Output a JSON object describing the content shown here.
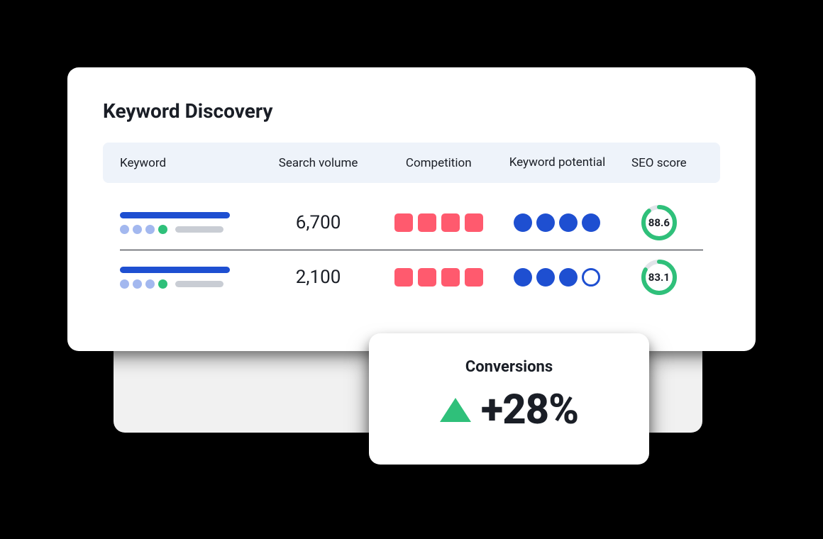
{
  "card": {
    "title": "Keyword Discovery",
    "columns": {
      "keyword": "Keyword",
      "volume": "Search volume",
      "competition": "Competition",
      "potential": "Keyword potential",
      "score": "SEO score"
    },
    "rows": [
      {
        "volume": "6,700",
        "competition": 4,
        "potential_filled": 4,
        "potential_total": 4,
        "score": "88.6",
        "score_pct": 88.6
      },
      {
        "volume": "2,100",
        "competition": 4,
        "potential_filled": 3,
        "potential_total": 4,
        "score": "83.1",
        "score_pct": 83.1
      }
    ]
  },
  "conversions": {
    "title": "Conversions",
    "value": "+28%",
    "direction": "up"
  },
  "colors": {
    "blue": "#1e4fd1",
    "blue_light": "#a3b8ef",
    "green": "#2fc07a",
    "coral": "#ff5a6e",
    "grey": "#c9cdd4",
    "ring_bg": "#e1e4e9"
  }
}
